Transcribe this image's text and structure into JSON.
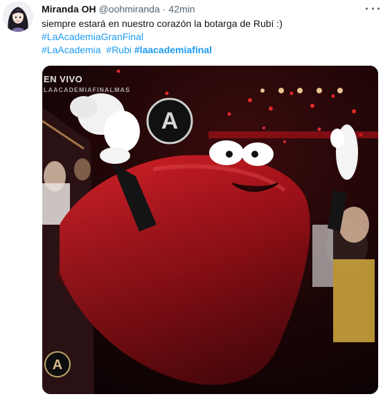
{
  "tweet": {
    "display_name": "Miranda OH",
    "handle": "@oohmiranda",
    "separator": "·",
    "time": "42min",
    "text": "siempre estará en nuestro corazón la botarga de Rubí :)",
    "hashtags_line1": [
      "#LaAcademiaGranFinal"
    ],
    "hashtags_line2": [
      "#LaAcademia",
      "#Rubi",
      "#laacademiafinal"
    ],
    "more_icon": "three-dots-icon"
  },
  "media": {
    "overlay_live": "EN VIVO",
    "overlay_sub": "LAACADEMIAFINALMAS",
    "logo_letter": "A",
    "description_icon": "red-mascot-image"
  },
  "colors": {
    "link": "#1d9bf0",
    "muted": "#536471",
    "text": "#0f1419",
    "mascot_red": "#b5141c"
  }
}
